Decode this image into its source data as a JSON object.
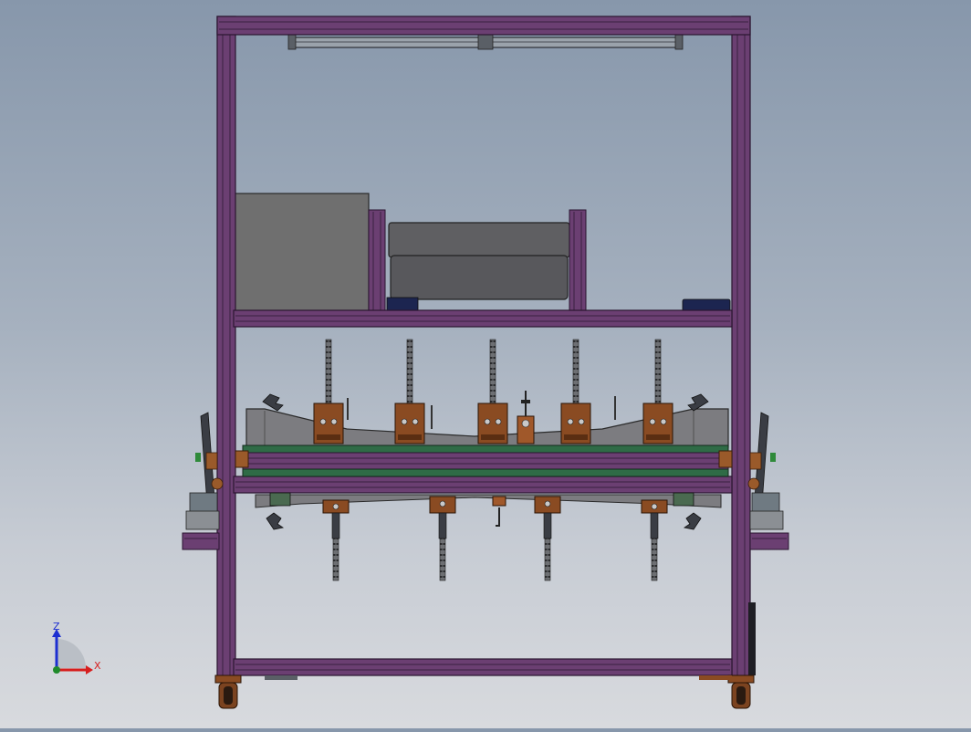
{
  "viewport": {
    "background_top": "#8797ab",
    "background_bottom": "#d8dade"
  },
  "model": {
    "frame_color": "#6b3f72",
    "frame_dark": "#3a2140",
    "plate_color": "#2f6b46",
    "clamp_color": "#8a4b22",
    "box_color": "#6d6d6d",
    "cylinder_color": "#3a3d44"
  },
  "triad": {
    "z_label": "Z",
    "x_label": "X",
    "z_color": "#1d2fd1",
    "x_color": "#d61e1e",
    "origin_color": "#1f8a2a"
  }
}
